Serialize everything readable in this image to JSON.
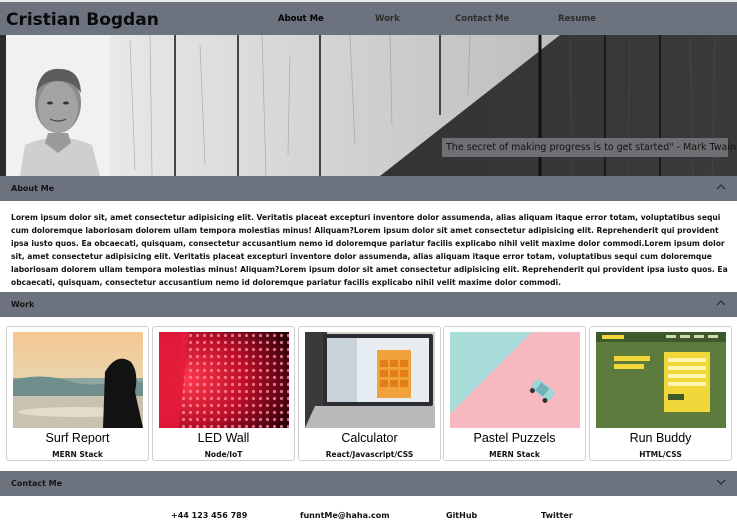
{
  "nav": {
    "brand": "Cristian Bogdan",
    "links": [
      {
        "label": "About Me"
      },
      {
        "label": "Work"
      },
      {
        "label": "Contact Me"
      },
      {
        "label": "Resume"
      }
    ]
  },
  "hero": {
    "quote": "The secret of making progress is to get started\" - Mark Twain"
  },
  "about": {
    "title": "About Me",
    "text": "Lorem ipsum dolor sit, amet consectetur adipisicing elit. Veritatis placeat excepturi inventore dolor assumenda, alias aliquam itaque error totam, voluptatibus sequi cum doloremque laboriosam dolorem ullam tempora molestias minus! Aliquam?Lorem ipsum dolor sit amet consectetur adipisicing elit. Reprehenderit qui provident ipsa iusto quos. Ea obcaecati, quisquam, consectetur accusantium nemo id doloremque pariatur facilis explicabo nihil velit maxime dolor commodi.Lorem ipsum dolor sit, amet consectetur adipisicing elit. Veritatis placeat excepturi inventore dolor assumenda, alias aliquam itaque error totam, voluptatibus sequi cum doloremque laboriosam dolorem ullam tempora molestias minus! Aliquam?Lorem ipsum dolor sit amet consectetur adipisicing elit. Reprehenderit qui provident ipsa iusto quos. Ea obcaecati, quisquam, consectetur accusantium nemo id doloremque pariatur facilis explicabo nihil velit maxime dolor commodi."
  },
  "work": {
    "title": "Work",
    "projects": [
      {
        "title": "Surf Report",
        "stack": "MERN Stack"
      },
      {
        "title": "LED Wall",
        "stack": "Node/IoT"
      },
      {
        "title": "Calculator",
        "stack": "React/Javascript/CSS"
      },
      {
        "title": "Pastel Puzzels",
        "stack": "MERN Stack"
      },
      {
        "title": "Run Buddy",
        "stack": "HTML/CSS"
      }
    ]
  },
  "contact": {
    "title": "Contact Me",
    "phone": "+44 123 456 789",
    "email": "funntMe@haha.com",
    "github": "GitHub",
    "twitter": "Twitter"
  },
  "colors": {
    "header_bar": "#6c737e",
    "quote_bg": "#6d6f72"
  },
  "icons": {
    "section_toggle": "chevron-up-icon",
    "contact_toggle": "chevron-down-icon"
  }
}
